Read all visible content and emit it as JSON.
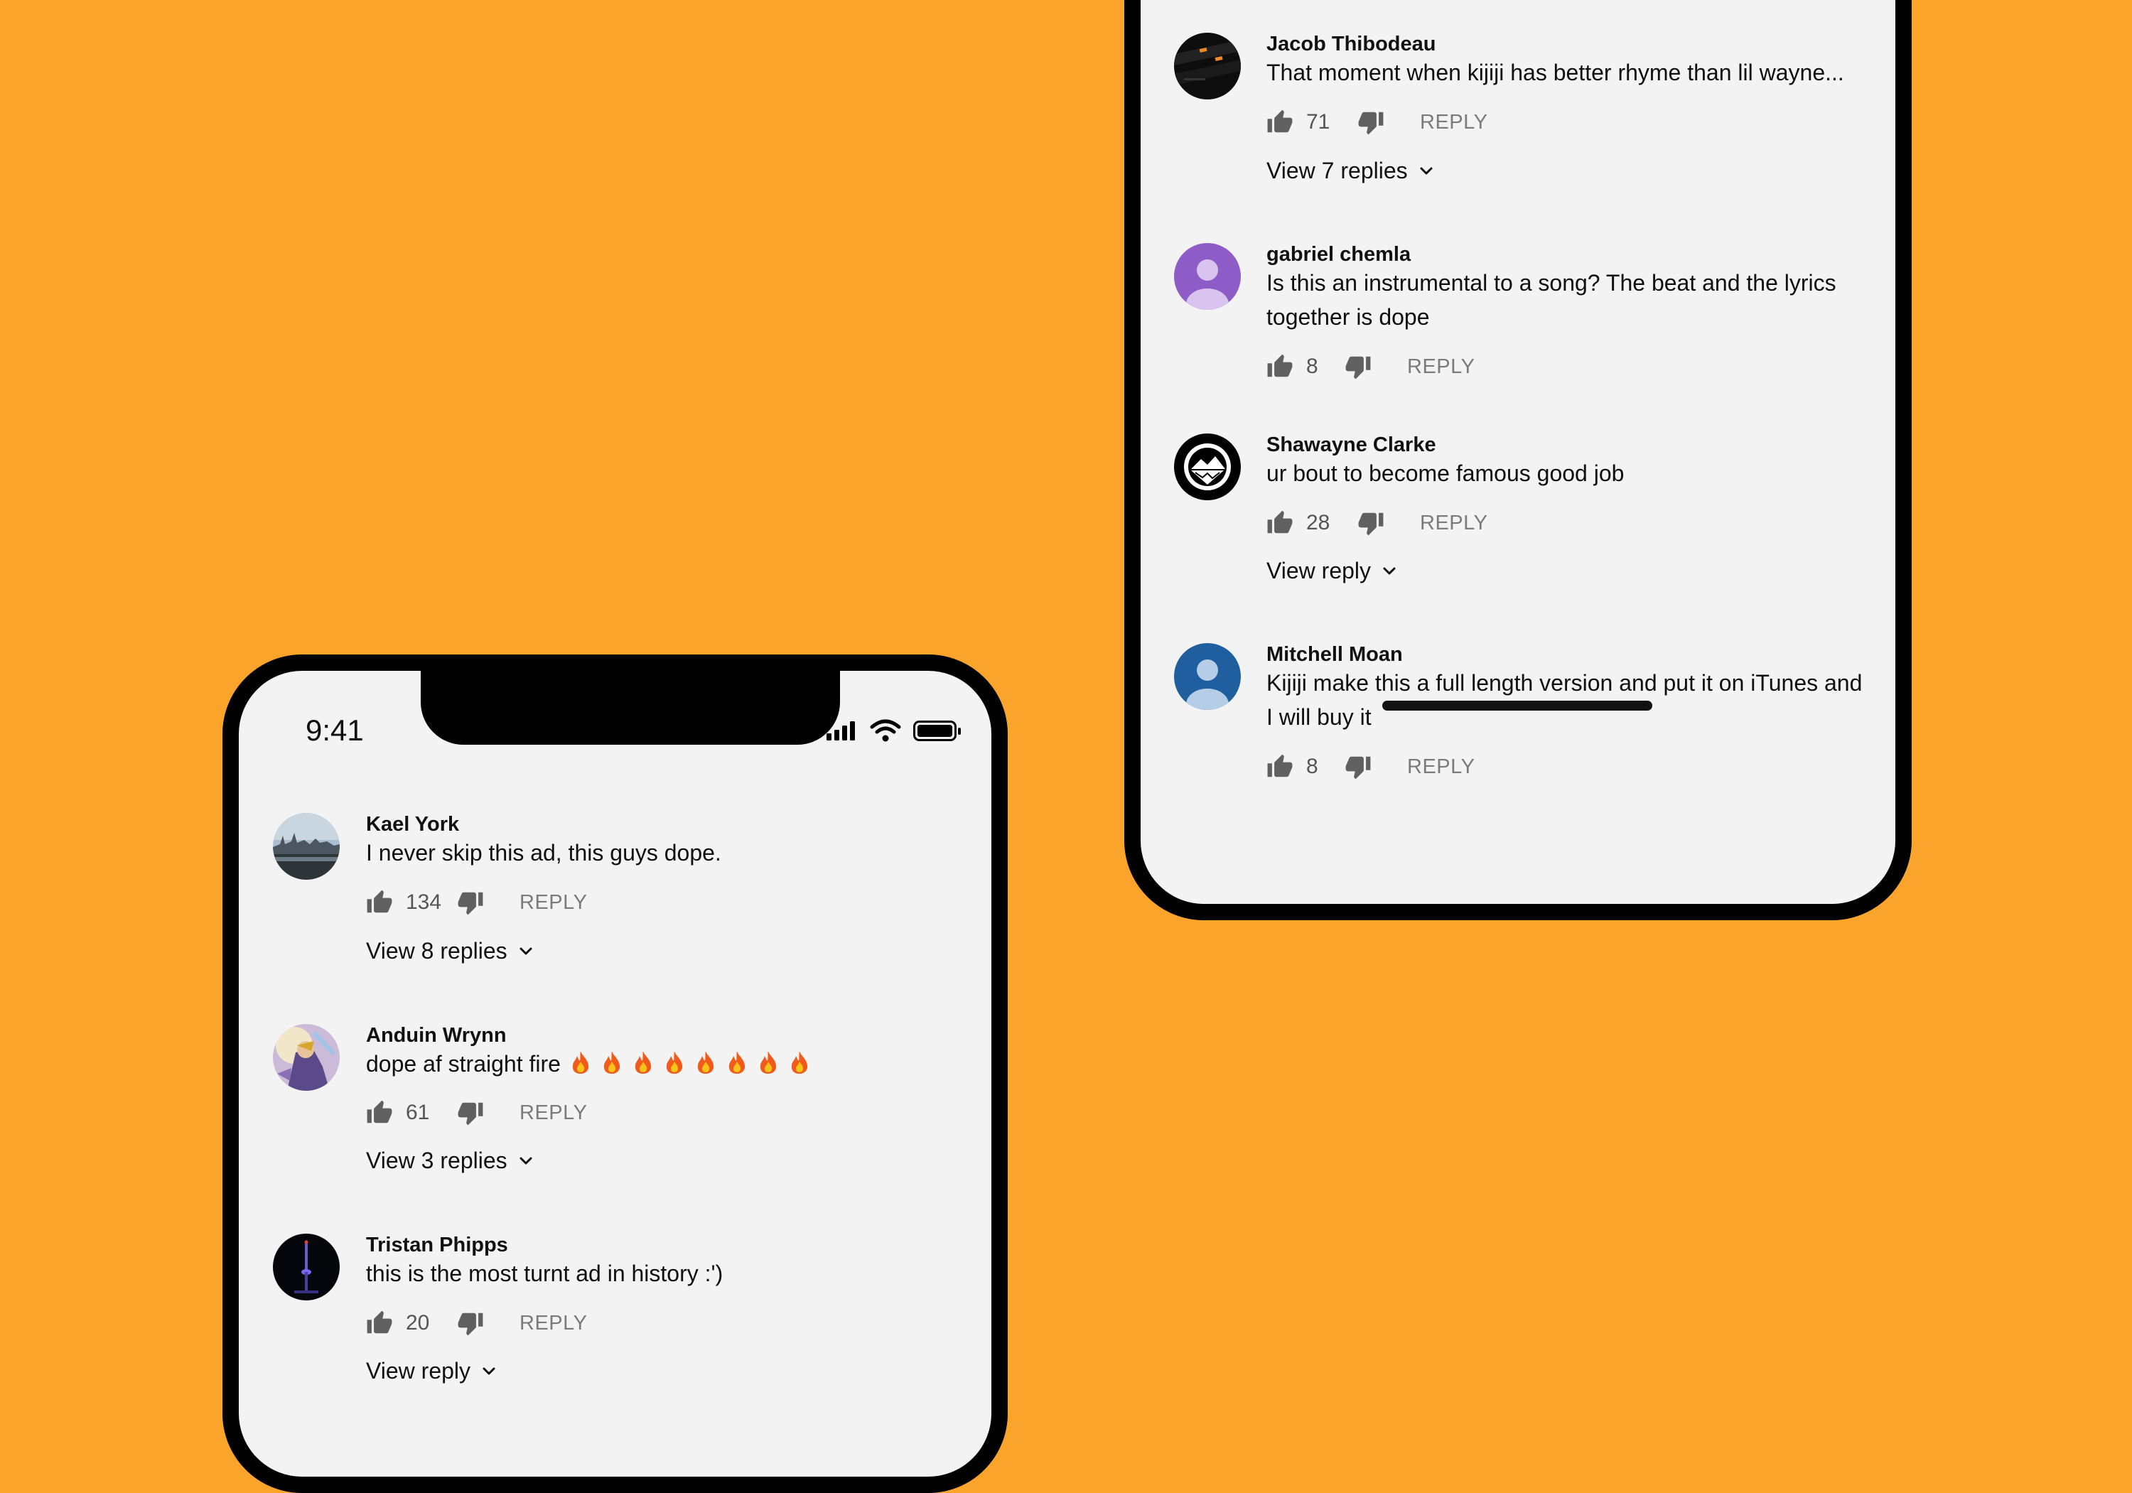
{
  "colors": {
    "background": "#FBA42C",
    "screen": "#f3f3f3",
    "bezel": "#000000",
    "meta_text": "#555555",
    "reply_text": "#7b7b7b"
  },
  "status_bar": {
    "time": "9:41",
    "icons": [
      "cellular-signal-icon",
      "wifi-icon",
      "battery-icon"
    ]
  },
  "left_phone": {
    "comments": [
      {
        "author": "Kael York",
        "text": "I never skip this ad, this guys dope.",
        "likes": "134",
        "reply_label": "REPLY",
        "view_replies": "View 8 replies"
      },
      {
        "author": "Anduin Wrynn",
        "text": "dope af straight fire",
        "emoji": "🔥🔥🔥🔥🔥🔥🔥🔥",
        "likes": "61",
        "reply_label": "REPLY",
        "view_replies": "View 3 replies"
      },
      {
        "author": "Tristan Phipps",
        "text": "this is the most turnt ad in history :')",
        "likes": "20",
        "reply_label": "REPLY",
        "view_replies": "View reply"
      }
    ]
  },
  "right_phone": {
    "comments": [
      {
        "author": "Jacob Thibodeau",
        "text": "That moment when kijiji has better rhyme than lil wayne...",
        "likes": "71",
        "reply_label": "REPLY",
        "view_replies": "View 7 replies"
      },
      {
        "author": "gabriel chemla",
        "text": "Is this an instrumental to a song? The beat and the lyrics together is dope",
        "likes": "8",
        "reply_label": "REPLY"
      },
      {
        "author": "Shawayne Clarke",
        "text": "ur bout to become famous good job",
        "likes": "28",
        "reply_label": "REPLY",
        "view_replies": "View reply"
      },
      {
        "author": "Mitchell Moan",
        "text": "Kijiji make this a full length version and put it on iTunes and I will buy it",
        "likes": "8",
        "reply_label": "REPLY"
      }
    ]
  }
}
